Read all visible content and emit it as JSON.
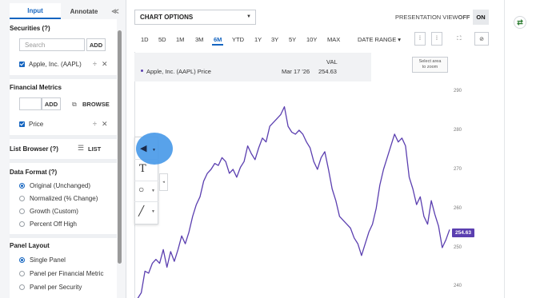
{
  "sidebar": {
    "tabs": {
      "input": "Input",
      "annotate": "Annotate",
      "collapse": "≪"
    },
    "securities": {
      "title": "Securities (?)",
      "search_placeholder": "Search",
      "add": "ADD",
      "item": "Apple, Inc. (AAPL)"
    },
    "financial_metrics": {
      "title": "Financial Metrics",
      "add": "ADD",
      "browse": "BROWSE",
      "item": "Price"
    },
    "list_browser": {
      "title": "List Browser (?)",
      "list": "LIST"
    },
    "data_format": {
      "title": "Data Format (?)",
      "options": [
        "Original (Unchanged)",
        "Normalized (% Change)",
        "Growth (Custom)",
        "Percent Off High"
      ],
      "selected": 0
    },
    "panel_layout": {
      "title": "Panel Layout",
      "options": [
        "Single Panel",
        "Panel per Financial Metric",
        "Panel per Security"
      ],
      "selected": 0
    }
  },
  "toolbar": {
    "chart_options": "CHART OPTIONS",
    "presentation_view": "PRESENTATION VIEW",
    "off": "OFF",
    "on": "ON",
    "ranges": [
      "1D",
      "5D",
      "1M",
      "3M",
      "6M",
      "YTD",
      "1Y",
      "3Y",
      "5Y",
      "10Y",
      "MAX"
    ],
    "active_range": "6M",
    "date_range": "DATE RANGE",
    "date_range_caret": "▾"
  },
  "legend": {
    "series": "Apple, Inc. (AAPL) Price",
    "date": "Mar 17 '26",
    "value_header": "VAL",
    "value": "254.63"
  },
  "zoom_hint": {
    "line1": "Select area",
    "line2": "to zoom"
  },
  "chart_data": {
    "type": "line",
    "series": [
      {
        "name": "Apple, Inc. (AAPL) Price",
        "values": [
          237,
          238.5,
          244,
          243.5,
          246,
          247,
          246,
          249.5,
          245,
          249,
          246.5,
          249.5,
          253,
          251,
          254,
          258,
          261,
          263,
          267,
          269,
          270,
          271.5,
          271,
          273,
          272,
          269,
          270,
          268,
          270.5,
          272,
          276,
          274,
          272.5,
          275.5,
          278,
          277,
          281,
          282,
          283,
          284,
          286,
          281,
          279.5,
          279,
          280,
          279,
          277,
          275.5,
          272,
          270,
          273,
          274.5,
          270,
          265,
          262,
          258,
          257,
          256,
          255,
          252.5,
          251,
          248,
          251,
          254,
          256,
          260,
          266,
          270,
          273,
          276,
          279,
          277,
          278,
          276,
          268,
          265,
          261,
          263,
          258,
          256,
          262,
          258.5,
          255.5,
          250,
          252,
          254.63
        ]
      }
    ],
    "yticks": [
      240,
      250,
      260,
      270,
      280,
      290
    ],
    "last_value_label": "254.63",
    "color": "#5b3fb0"
  },
  "tools": {
    "pointer": "pointer-icon",
    "text": "text-icon",
    "circle": "circle-icon",
    "line": "line-icon"
  }
}
